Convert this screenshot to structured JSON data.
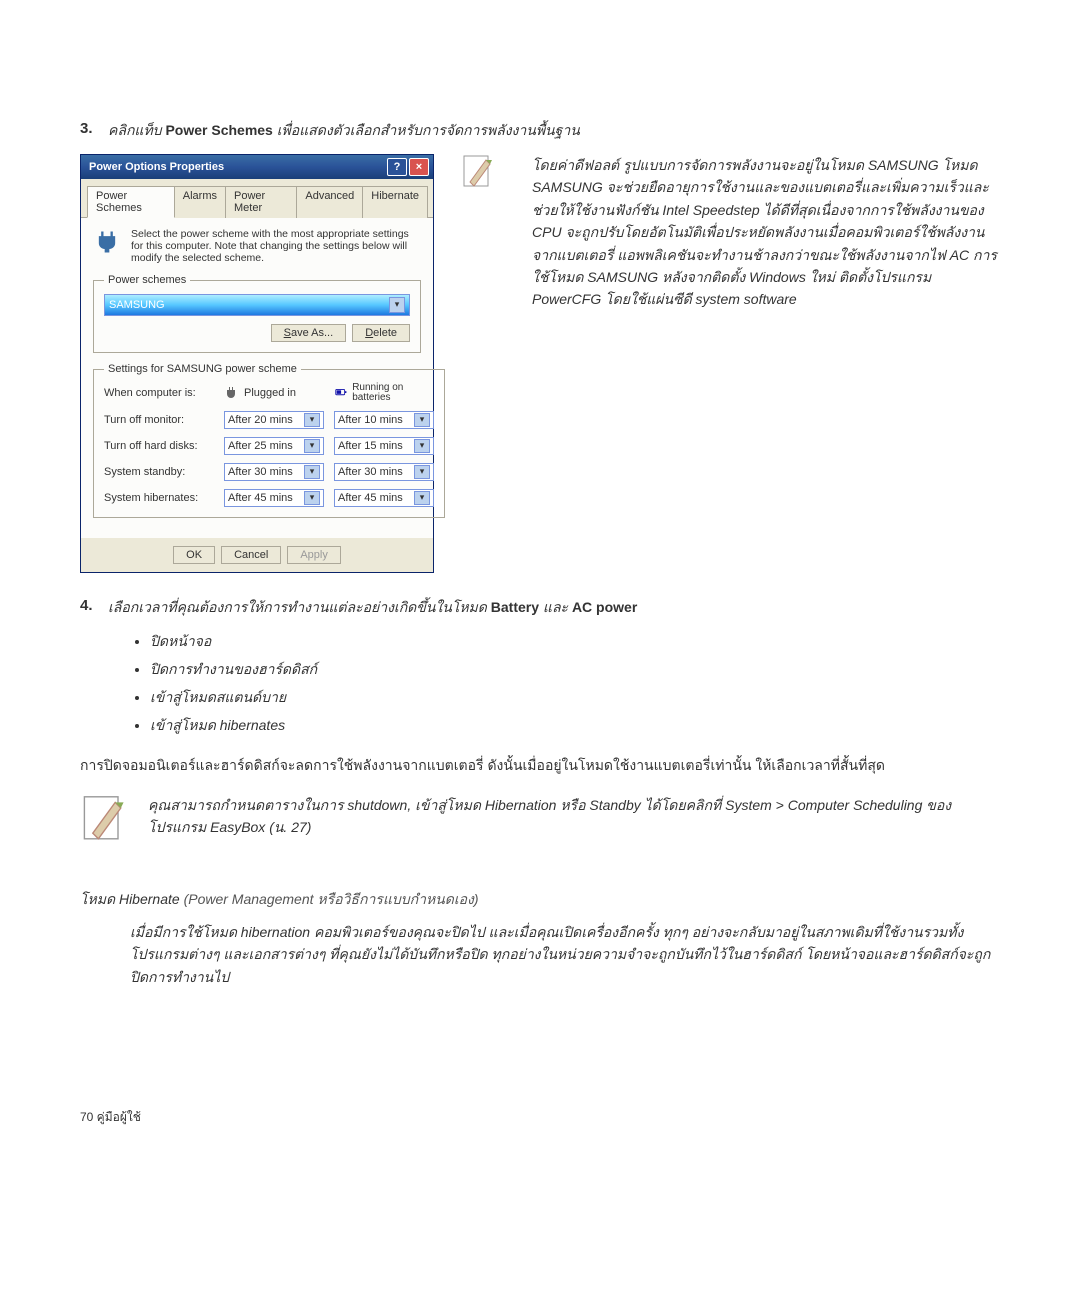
{
  "step3": {
    "num": "3.",
    "pre": "คลิกแท็บ ",
    "bold": "Power Schemes",
    "post": " เพื่อแสดงตัวเลือกสำหรับการจัดการพลังงานพื้นฐาน"
  },
  "dialog": {
    "title": "Power Options Properties",
    "help": "?",
    "close": "×",
    "tabs": {
      "t1": "Power Schemes",
      "t2": "Alarms",
      "t3": "Power Meter",
      "t4": "Advanced",
      "t5": "Hibernate"
    },
    "desc": "Select the power scheme with the most appropriate settings for this computer. Note that changing the settings below will modify the selected scheme.",
    "fs1_legend": "Power schemes",
    "scheme": "SAMSUNG",
    "save_as": "Save As...",
    "delete": "Delete",
    "fs2_legend": "Settings for SAMSUNG power scheme",
    "col_label": "When computer is:",
    "col_plugged": "Plugged in",
    "col_batt": "Running on batteries",
    "rows": {
      "r1": {
        "label": "Turn off monitor:",
        "v1": "After 20 mins",
        "v2": "After 10 mins"
      },
      "r2": {
        "label": "Turn off hard disks:",
        "v1": "After 25 mins",
        "v2": "After 15 mins"
      },
      "r3": {
        "label": "System standby:",
        "v1": "After 30 mins",
        "v2": "After 30 mins"
      },
      "r4": {
        "label": "System hibernates:",
        "v1": "After 45 mins",
        "v2": "After 45 mins"
      }
    },
    "ok": "OK",
    "cancel": "Cancel",
    "apply": "Apply"
  },
  "explain": {
    "p": "โดยค่าดีฟอลต์ รูปแบบการจัดการพลังงานจะอยู่ในโหมด SAMSUNG   โหมด SAMSUNG จะช่วยยืดอายุการใช้งานและของแบตเตอรี่และเพิ่มความเร็วและช่วยให้ใช้งานฟังก์ชัน Intel Speedstep ได้ดีที่สุดเนื่องจากการใช้พลังงานของ CPU จะถูกปรับโดยอัตโนมัติเพื่อประหยัดพลังงานเมื่อคอมพิวเตอร์ใช้พลังงานจากแบตเตอรี่ แอพพลิเคชันจะทำงานช้าลงกว่าขณะใช้พลังงานจากไฟ AC การใช้โหมด SAMSUNG หลังจากติดตั้ง Windows ใหม่ ติดตั้งโปรแกรม PowerCFG โดยใช้แผ่นซีดี system software"
  },
  "step4": {
    "num": "4.",
    "pre": "เลือกเวลาที่คุณต้องการให้การทำงานแต่ละอย่างเกิดขึ้นในโหมด ",
    "b1": "Battery",
    "mid": " และ ",
    "b2": "AC power"
  },
  "bullets": {
    "b1": "ปิดหน้าจอ",
    "b2": "ปิดการทำงานของฮาร์ดดิสก์",
    "b3": "เข้าสู่โหมดสแตนด์บาย",
    "b4": "เข้าสู่โหมด hibernates"
  },
  "para1": "การปิดจอมอนิเตอร์และฮาร์ดดิสก์จะลดการใช้พลังงานจากแบตเตอรี่ ดังนั้นเมื่ออยู่ในโหมดใช้งานแบตเตอรี่เท่านั้น ให้เลือกเวลาที่สั้นที่สุด",
  "tip": "คุณสามารถกำหนดตารางในการ shutdown, เข้าสู่โหมด Hibernation หรือ Standby ได้โดยคลิกที่ System > Computer Scheduling ของโปรแกรม EasyBox (น. 27)",
  "heading": "โหมด Hibernate (Power Management หรือวิธีการแบบกำหนดเอง)",
  "indent": "เมื่อมีการใช้โหมด hibernation คอมพิวเตอร์ของคุณจะปิดไป และเมื่อคุณเปิดเครื่องอีกครั้ง ทุกๆ อย่างจะกลับมาอยู่ในสภาพเดิมที่ใช้งานรวมทั้งโปรแกรมต่างๆ และเอกสารต่างๆ ที่คุณยังไม่ได้บันทึกหรือปิด ทุกอย่างในหน่วยความจำจะถูกบันทึกไว้ในฮาร์ดดิสก์ โดยหน้าจอและฮาร์ดดิสก์จะถูกปิดการทำงานไป",
  "footer": "70 คู่มือผู้ใช้"
}
